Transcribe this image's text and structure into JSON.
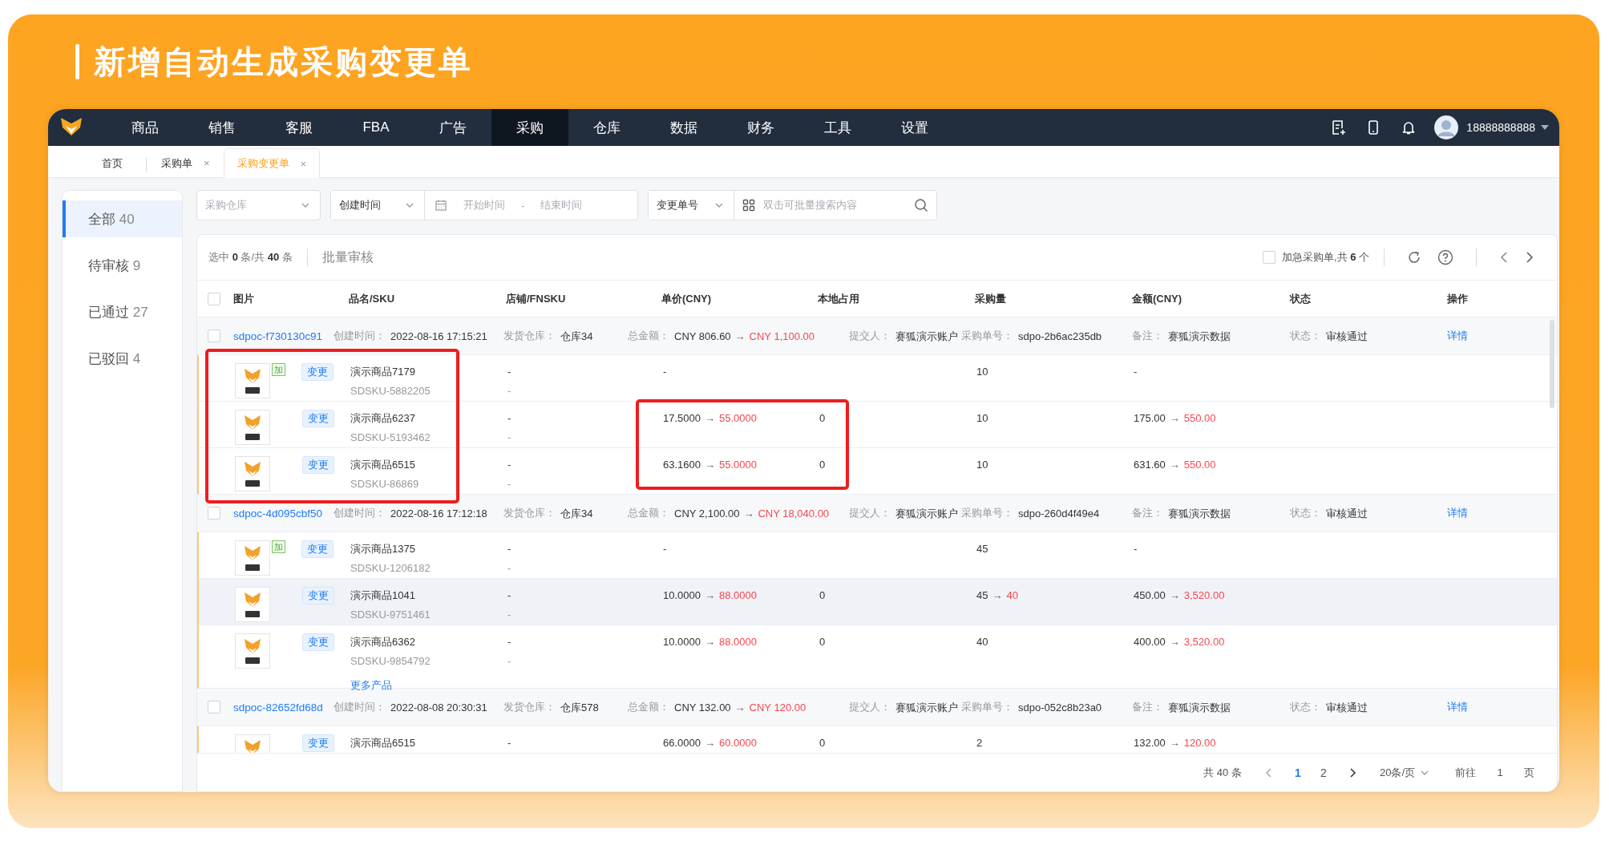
{
  "banner": {
    "title": "新增自动生成采购变更单"
  },
  "nav": {
    "items": [
      {
        "label": "商品",
        "selected": false
      },
      {
        "label": "销售",
        "selected": false
      },
      {
        "label": "客服",
        "selected": false
      },
      {
        "label": "FBA",
        "selected": false
      },
      {
        "label": "广告",
        "selected": false
      },
      {
        "label": "采购",
        "selected": true
      },
      {
        "label": "仓库",
        "selected": false
      },
      {
        "label": "数据",
        "selected": false
      },
      {
        "label": "财务",
        "selected": false
      },
      {
        "label": "工具",
        "selected": false
      },
      {
        "label": "设置",
        "selected": false
      }
    ],
    "user": "18888888888"
  },
  "tabs": [
    {
      "label": "首页",
      "selected": false
    },
    {
      "label": "采购单",
      "selected": false,
      "close": "×"
    },
    {
      "label": "采购变更单",
      "selected": true,
      "close": "×"
    }
  ],
  "sidebar": {
    "items": [
      {
        "label": "全部",
        "count": "40",
        "selected": true
      },
      {
        "label": "待审核",
        "count": "9",
        "selected": false
      },
      {
        "label": "已通过",
        "count": "27",
        "selected": false
      },
      {
        "label": "已驳回",
        "count": "4",
        "selected": false
      }
    ]
  },
  "filters": {
    "warehouse": {
      "placeholder": "采购仓库"
    },
    "date_type": {
      "value": "创建时间"
    },
    "date_range": {
      "start_placeholder": "开始时间",
      "separator": "-",
      "end_placeholder": "结束时间"
    },
    "search_type": {
      "value": "变更单号"
    },
    "search": {
      "placeholder": "双击可批量搜索内容"
    }
  },
  "toolbar": {
    "selection": "选中 **0** 条/共 **40** 条",
    "bulk_button": {
      "label": "批量审核",
      "disabled": true
    },
    "urgent": {
      "label": "加急采购单,共 **6** 个",
      "checked": false
    }
  },
  "table": {
    "header_checked": false,
    "columns": [
      "图片",
      "品名/SKU",
      "店铺/FNSKU",
      "单价(CNY)",
      "本地占用",
      "采购量",
      "金额(CNY)",
      "状态",
      "操作"
    ],
    "orders": [
      {
        "checked": false,
        "order_no": "sdpoc-f730130c91",
        "fields": [
          {
            "label": "创建时间：",
            "value": "2022-08-16 17:15:21"
          },
          {
            "label": "发货仓库：",
            "value": "仓库34"
          },
          {
            "label": "总金额：",
            "value": "CNY 806.60",
            "arrow": "→",
            "new_value": "CNY 1,100.00"
          },
          {
            "label": "提交人：",
            "value": "赛狐演示账户"
          },
          {
            "label": "采购单号：",
            "value": "sdpo-2b6ac235db"
          },
          {
            "label": "备注：",
            "value": "赛狐演示数据"
          },
          {
            "label": "状态：",
            "value": "审核通过"
          }
        ],
        "action": "详情",
        "products": [
          {
            "added_tag": "加",
            "change_tag": "变更",
            "name": "演示商品7179",
            "sku": "SDSKU-5882205",
            "shop": "-",
            "fnsku": "-",
            "unit_price": {
              "value": "-"
            },
            "qty": {
              "value": "10"
            },
            "amount": {
              "value": "-"
            },
            "hovered": false
          },
          {
            "change_tag": "变更",
            "name": "演示商品6237",
            "sku": "SDSKU-5193462",
            "shop": "-",
            "fnsku": "-",
            "unit_price": {
              "value": "17.5000",
              "arrow": "→",
              "new_value": "55.0000"
            },
            "local": "0",
            "qty": {
              "value": "10"
            },
            "amount": {
              "value": "175.00",
              "arrow": "→",
              "new_value": "550.00"
            },
            "hovered": false
          },
          {
            "change_tag": "变更",
            "name": "演示商品6515",
            "sku": "SDSKU-86869",
            "shop": "-",
            "fnsku": "-",
            "unit_price": {
              "value": "63.1600",
              "arrow": "→",
              "new_value": "55.0000"
            },
            "local": "0",
            "qty": {
              "value": "10"
            },
            "amount": {
              "value": "631.60",
              "arrow": "→",
              "new_value": "550.00"
            },
            "hovered": false
          }
        ]
      },
      {
        "checked": false,
        "order_no": "sdpoc-4d095cbf50",
        "fields": [
          {
            "label": "创建时间：",
            "value": "2022-08-16 17:12:18"
          },
          {
            "label": "发货仓库：",
            "value": "仓库34"
          },
          {
            "label": "总金额：",
            "value": "CNY 2,100.00",
            "arrow": "→",
            "new_value": "CNY 18,040.00"
          },
          {
            "label": "提交人：",
            "value": "赛狐演示账户"
          },
          {
            "label": "采购单号：",
            "value": "sdpo-260d4f49e4"
          },
          {
            "label": "备注：",
            "value": "赛狐演示数据"
          },
          {
            "label": "状态：",
            "value": "审核通过"
          }
        ],
        "action": "详情",
        "products": [
          {
            "added_tag": "加",
            "change_tag": "变更",
            "name": "演示商品1375",
            "sku": "SDSKU-1206182",
            "shop": "-",
            "fnsku": "-",
            "unit_price": {
              "value": "-"
            },
            "qty": {
              "value": "45"
            },
            "amount": {
              "value": "-"
            },
            "hovered": false
          },
          {
            "change_tag": "变更",
            "name": "演示商品1041",
            "sku": "SDSKU-9751461",
            "shop": "-",
            "fnsku": "-",
            "unit_price": {
              "value": "10.0000",
              "arrow": "→",
              "new_value": "88.0000"
            },
            "local": "0",
            "qty": {
              "value": "45",
              "arrow": "→",
              "new_value": "40"
            },
            "amount": {
              "value": "450.00",
              "arrow": "→",
              "new_value": "3,520.00"
            },
            "hovered": true
          },
          {
            "change_tag": "变更",
            "name": "演示商品6362",
            "sku": "SDSKU-9854792",
            "shop": "-",
            "fnsku": "-",
            "unit_price": {
              "value": "10.0000",
              "arrow": "→",
              "new_value": "88.0000"
            },
            "local": "0",
            "qty": {
              "value": "40"
            },
            "amount": {
              "value": "400.00",
              "arrow": "→",
              "new_value": "3,520.00"
            },
            "hovered": false
          }
        ],
        "more_link": "更多产品"
      },
      {
        "checked": false,
        "order_no": "sdpoc-82652fd68d",
        "fields": [
          {
            "label": "创建时间：",
            "value": "2022-08-08 20:30:31"
          },
          {
            "label": "发货仓库：",
            "value": "仓库578"
          },
          {
            "label": "总金额：",
            "value": "CNY 132.00",
            "arrow": "→",
            "new_value": "CNY 120.00"
          },
          {
            "label": "提交人：",
            "value": "赛狐演示账户"
          },
          {
            "label": "采购单号：",
            "value": "sdpo-052c8b23a0"
          },
          {
            "label": "备注：",
            "value": "赛狐演示数据"
          },
          {
            "label": "状态：",
            "value": "审核通过"
          }
        ],
        "action": "详情",
        "products": [
          {
            "change_tag": "变更",
            "name": "演示商品6515",
            "shop": "-",
            "unit_price": {
              "value": "66.0000",
              "arrow": "→",
              "new_value": "60.0000"
            },
            "local": "0",
            "qty": {
              "value": "2"
            },
            "amount": {
              "value": "132.00",
              "arrow": "→",
              "new_value": "120.00"
            },
            "hovered": false
          }
        ]
      }
    ]
  },
  "pagination": {
    "total": "共 40 条",
    "pages": [
      {
        "label": "1",
        "selected": true
      },
      {
        "label": "2",
        "selected": false
      }
    ],
    "page_size": "20条/页",
    "goto_label": "前往",
    "goto_value": "1",
    "page_unit": "页"
  }
}
